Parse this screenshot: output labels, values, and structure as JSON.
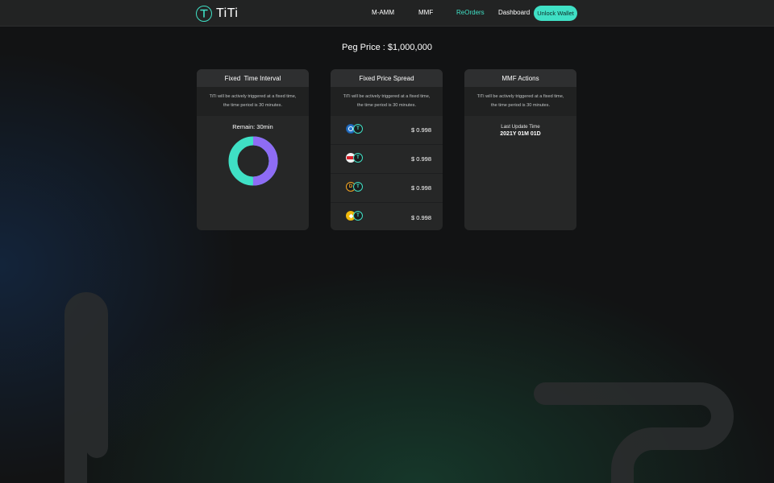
{
  "app": {
    "brand": "TiTi",
    "accent": "#3fe0c5"
  },
  "nav": {
    "items": [
      {
        "label": "M-AMM"
      },
      {
        "label": "MMF"
      },
      {
        "label": "ReOrders"
      },
      {
        "label": "Dashboard"
      }
    ],
    "active": "ReOrders",
    "unlock_label": "Unlock Wallet"
  },
  "peg": {
    "text": "Peg Price : $1,000,000"
  },
  "cards": {
    "interval": {
      "title": "Fixed  Time Interval",
      "desc_line1": "TiTi will be actively triggered at a fixed time,",
      "desc_line2": "the time period is 30 minutes.",
      "remain": "Remain: 30min",
      "progress_fraction": 0.5,
      "progress_colors": {
        "filled": "#8e6cf5",
        "remaining": "#3fe0c5"
      }
    },
    "spread": {
      "title": "Fixed Price Spread",
      "desc_line1": "TiTi will be actively triggered at a fixed time,",
      "desc_line2": "the time period is 30 minutes.",
      "rows": [
        {
          "coin_icon": "usdc-icon",
          "price": "$ 0.998"
        },
        {
          "coin_icon": "red-token-icon",
          "price": "$ 0.998"
        },
        {
          "coin_icon": "dai-icon",
          "price": "$ 0.998"
        },
        {
          "coin_icon": "busd-icon",
          "price": "$ 0.998"
        }
      ]
    },
    "mmf": {
      "title": "MMF Actions",
      "desc_line1": "TiTi will be actively triggered at a fixed time,",
      "desc_line2": "the time period is 30 minutes.",
      "update_label": "Last Update Time",
      "update_value": "2021Y 01M 01D"
    }
  }
}
